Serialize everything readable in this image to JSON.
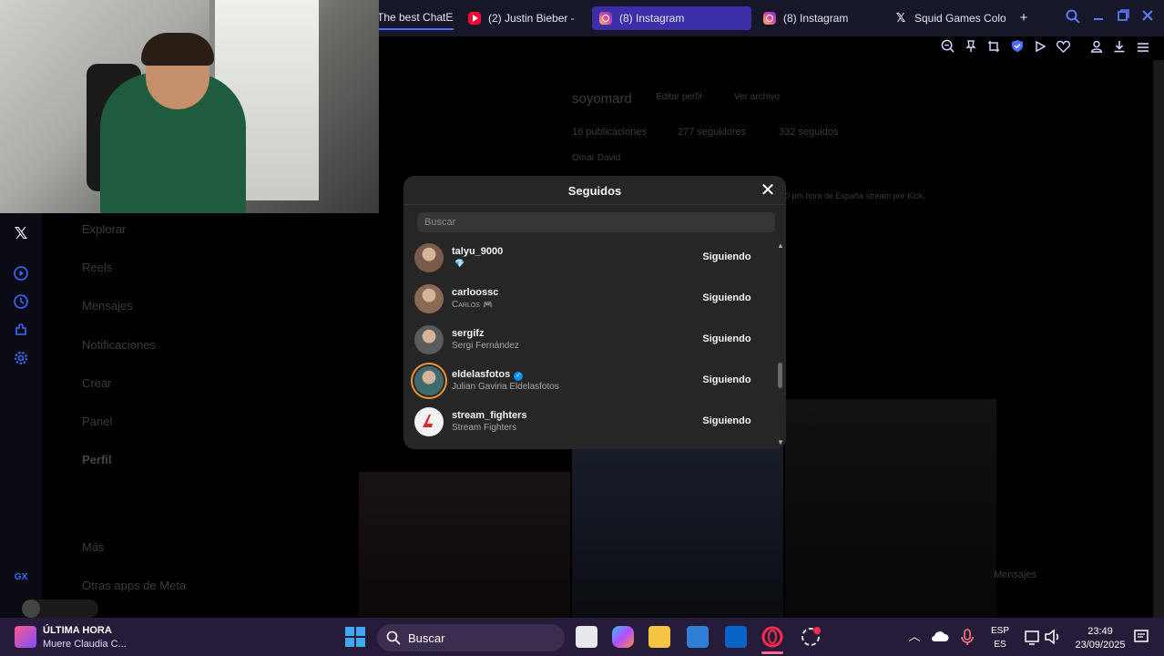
{
  "tabs": [
    {
      "label": "The best ChatE",
      "icon": "none"
    },
    {
      "label": "(2) Justin Bieber -",
      "icon": "youtube-icon"
    },
    {
      "label": "(8) Instagram",
      "icon": "instagram-icon"
    },
    {
      "label": "(8) Instagram",
      "icon": "instagram-icon"
    },
    {
      "label": "Squid Games Colo",
      "icon": "x-icon"
    }
  ],
  "new_tab_glyph": "+",
  "sidebar": {
    "items": [
      {
        "label": "Explorar"
      },
      {
        "label": "Reels"
      },
      {
        "label": "Mensajes"
      },
      {
        "label": "Notificaciones"
      },
      {
        "label": "Crear"
      },
      {
        "label": "Panel"
      },
      {
        "label": "Perfil"
      },
      {
        "label": "Más"
      },
      {
        "label": "Otras apps de Meta"
      }
    ],
    "gx_label": "GX"
  },
  "profile_bg": {
    "username": "soyomard",
    "edit_profile": "Editar perfil",
    "view_archive": "Ver archivo",
    "posts": "16 publicaciones",
    "followers": "277 seguidores",
    "following": "332 seguidos",
    "display_name": "Omar David",
    "bio": "0 pm hora de España stream por Kick.",
    "messages_label": "Mensajes"
  },
  "modal": {
    "title": "Seguidos",
    "close_glyph": "✕",
    "search_placeholder": "Buscar",
    "follow_label": "Siguiendo",
    "users": [
      {
        "username": "talyu_9000",
        "fullname": "",
        "verified": false,
        "badge": "💎",
        "ring": false,
        "avatar_color": "#7a5a4a"
      },
      {
        "username": "carloossc",
        "fullname": "Carlos",
        "verified": false,
        "badge": "🎮",
        "ring": false,
        "avatar_color": "#8a6a55"
      },
      {
        "username": "sergifz",
        "fullname": "Sergi Fernández",
        "verified": false,
        "badge": "",
        "ring": false,
        "avatar_color": "#5b5b5b"
      },
      {
        "username": "eldelasfotos",
        "fullname": "Julian Gaviria Eldelasfotos",
        "verified": true,
        "badge": "",
        "ring": true,
        "avatar_color": "#3f6b6e"
      },
      {
        "username": "stream_fighters",
        "fullname": "Stream Fighters",
        "verified": false,
        "badge": "",
        "ring": false,
        "avatar_color": "#e8e8e8"
      }
    ]
  },
  "taskbar": {
    "news_title": "ÚLTIMA HORA",
    "news_sub": "Muere Claudia C...",
    "search_label": "Buscar",
    "lang_top": "ESP",
    "lang_bottom": "ES",
    "time": "23:49",
    "date": "23/09/2025"
  },
  "colors": {
    "accent": "#3d6bff",
    "modal_bg": "#262626",
    "taskbar_bg": "#271b3a",
    "active_tab": "#3a2fa8"
  }
}
